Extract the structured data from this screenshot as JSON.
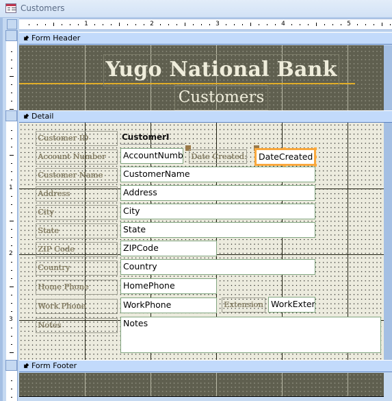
{
  "window": {
    "title": "Customers",
    "icon": "form-icon"
  },
  "ruler": {
    "horizontal_numbers": [
      "1",
      "2",
      "3",
      "4",
      "5"
    ],
    "vertical_numbers": [
      "1",
      "2",
      "3"
    ]
  },
  "sections": {
    "form_header": "Form Header",
    "detail": "Detail",
    "form_footer": "Form Footer"
  },
  "header": {
    "bank_title": "Yugo National Bank",
    "sub_title": "Customers",
    "accent_line_color": "#e2ae28"
  },
  "detail": {
    "fields": [
      {
        "label": "Customer ID",
        "control": "CustomerI",
        "type": "bound-text"
      },
      {
        "label": "Account Number",
        "control": "AccountNumb",
        "type": "textbox"
      },
      {
        "label": "Customer Name",
        "control": "CustomerName",
        "type": "textbox"
      },
      {
        "label": "Address",
        "control": "Address",
        "type": "textbox"
      },
      {
        "label": "City",
        "control": "City",
        "type": "textbox"
      },
      {
        "label": "State",
        "control": "State",
        "type": "textbox"
      },
      {
        "label": "ZIP Code",
        "control": "ZIPCode",
        "type": "textbox"
      },
      {
        "label": "Country",
        "control": "Country",
        "type": "textbox"
      },
      {
        "label": "Home Phone",
        "control": "HomePhone",
        "type": "textbox"
      },
      {
        "label": "Work Phone",
        "control": "WorkPhone",
        "type": "textbox"
      },
      {
        "label": "Notes",
        "control": "Notes",
        "type": "textarea"
      }
    ],
    "date_created": {
      "label": "Date Created:",
      "control": "DateCreated",
      "selected": true
    },
    "extension": {
      "label": "Extension",
      "control": "WorkExter"
    }
  },
  "colors": {
    "selection": "#f9a83d",
    "section_bar": "#c2dafb",
    "header_bg": "#5f5f4f",
    "detail_bg": "#ecebde"
  }
}
